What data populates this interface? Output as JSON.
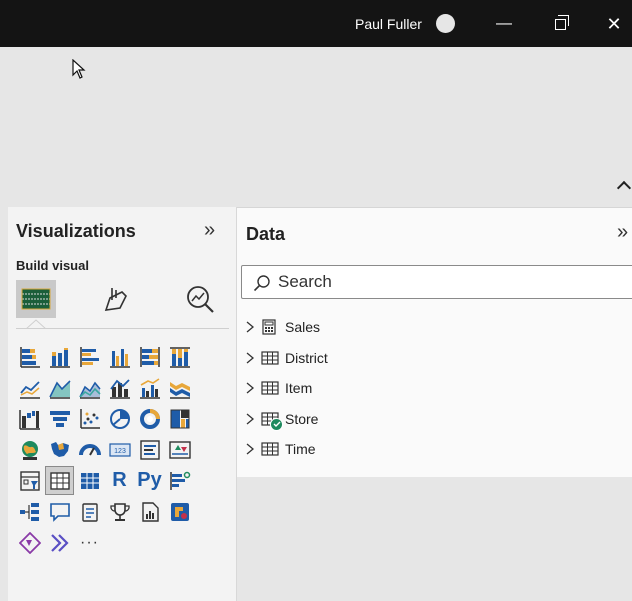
{
  "titlebar": {
    "user_name": "Paul Fuller",
    "minimize_glyph": "—",
    "close_glyph": "✕"
  },
  "visualizations": {
    "title": "Visualizations",
    "expand_glyph": "»",
    "build_label": "Build visual",
    "tabs": [
      "build-visual-tab",
      "format-visual-tab",
      "analytics-tab"
    ],
    "icons": [
      "stacked-bar-chart-icon",
      "stacked-column-chart-icon",
      "clustered-bar-chart-icon",
      "clustered-column-chart-icon",
      "100-percent-stacked-bar-chart-icon",
      "100-percent-stacked-column-chart-icon",
      "line-chart-icon",
      "area-chart-icon",
      "stacked-area-chart-icon",
      "line-and-stacked-column-chart-icon",
      "line-and-clustered-column-chart-icon",
      "ribbon-chart-icon",
      "waterfall-chart-icon",
      "funnel-chart-icon",
      "scatter-chart-icon",
      "pie-chart-icon",
      "donut-chart-icon",
      "treemap-icon",
      "map-icon",
      "filled-map-icon",
      "gauge-icon",
      "card-icon",
      "multi-row-card-icon",
      "kpi-icon",
      "slicer-icon",
      "table-icon",
      "matrix-icon",
      "r-script-visual-icon",
      "python-visual-icon",
      "key-influencers-icon",
      "decomposition-tree-icon",
      "qa-icon",
      "smart-narrative-icon",
      "goals-icon",
      "paginated-report-icon",
      "power-apps-icon",
      "power-automate-icon",
      "get-more-visuals-icon",
      "more-options-icon"
    ],
    "r_label": "R",
    "py_label": "Py",
    "more_label": "···"
  },
  "data": {
    "title": "Data",
    "expand_glyph": "»",
    "search_placeholder": "Search",
    "tables": [
      {
        "name": "Sales",
        "icon": "calculator-table-icon"
      },
      {
        "name": "District",
        "icon": "table-icon"
      },
      {
        "name": "Item",
        "icon": "table-icon"
      },
      {
        "name": "Store",
        "icon": "table-icon",
        "badge": "check-badge-icon"
      },
      {
        "name": "Time",
        "icon": "table-icon"
      }
    ]
  },
  "colors": {
    "titlebar": "#141414",
    "accent_green": "#1e8a5e",
    "viz_blue": "#1f5ca8",
    "viz_yellow": "#e8a73a",
    "viz_teal": "#3aa7a0"
  }
}
